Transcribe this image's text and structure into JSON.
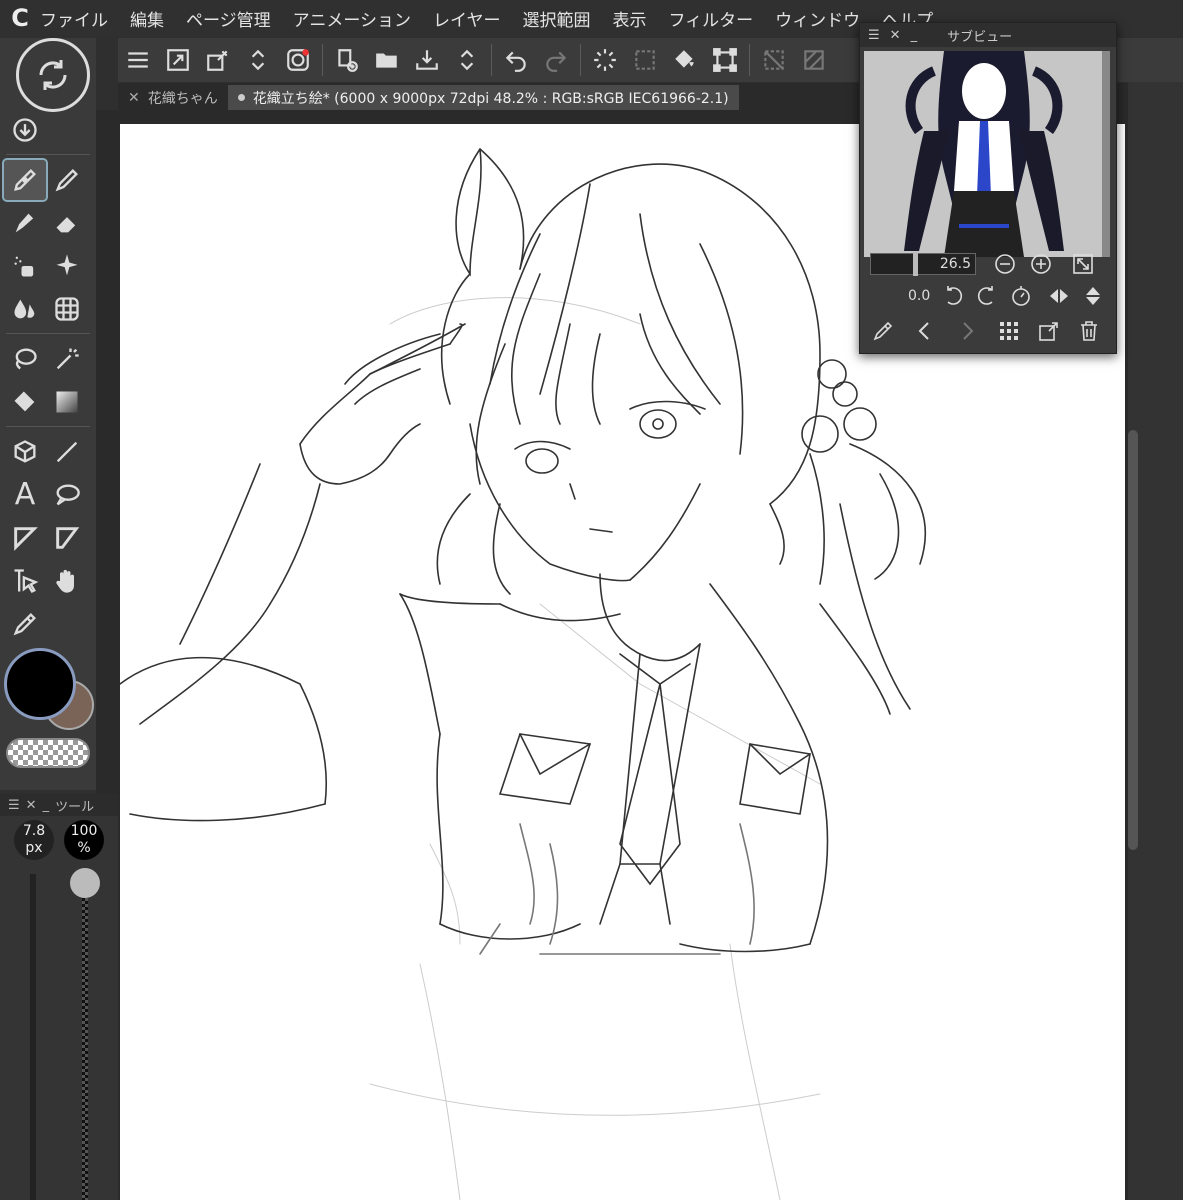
{
  "app": {
    "logo": "C"
  },
  "menu": [
    "ファイル",
    "編集",
    "ページ管理",
    "アニメーション",
    "レイヤー",
    "選択範囲",
    "表示",
    "フィルター",
    "ウィンドウ",
    "ヘルプ"
  ],
  "tabs": [
    {
      "label": "花織ちゃん",
      "active": false
    },
    {
      "label": "花織立ち絵* (6000 x 9000px 72dpi 48.2% : RGB:sRGB IEC61966-2.1)",
      "active": true
    }
  ],
  "tool_property": {
    "title": "ツール",
    "brush_size": "7.8",
    "brush_unit": "px",
    "opacity": "100",
    "opacity_unit": "%",
    "opacity_level": 1.0
  },
  "colors": {
    "main": "#000000",
    "sub": "#7a6458",
    "accent": "#8a9bc0"
  },
  "subview": {
    "title": "サブビュー",
    "zoom": "26.5",
    "rotation": "0.0"
  },
  "icons": {
    "toolbar": [
      "menu-icon",
      "resize-icon",
      "pen-settings-icon",
      "chevron-updown-icon",
      "record-icon",
      "new-file-icon",
      "open-folder-icon",
      "save-icon",
      "chevron-updown-icon",
      "undo-icon",
      "redo-icon",
      "loading-icon",
      "select-icon",
      "fill-icon",
      "transform-icon",
      "deselect-icon",
      "stripe-icon"
    ],
    "tools": [
      "pen-icon",
      "pencil-icon",
      "brush-icon",
      "eraser-icon",
      "airbrush-icon",
      "decoration-icon",
      "blend-icon",
      "mesh-icon",
      "lasso-icon",
      "magic-wand-icon",
      "fill-icon",
      "gradient-icon",
      "3d-icon",
      "line-icon",
      "text-icon",
      "balloon-icon",
      "frame-icon",
      "frame-cut-icon",
      "operation-icon",
      "hand-icon",
      "eyedropper-icon"
    ]
  }
}
